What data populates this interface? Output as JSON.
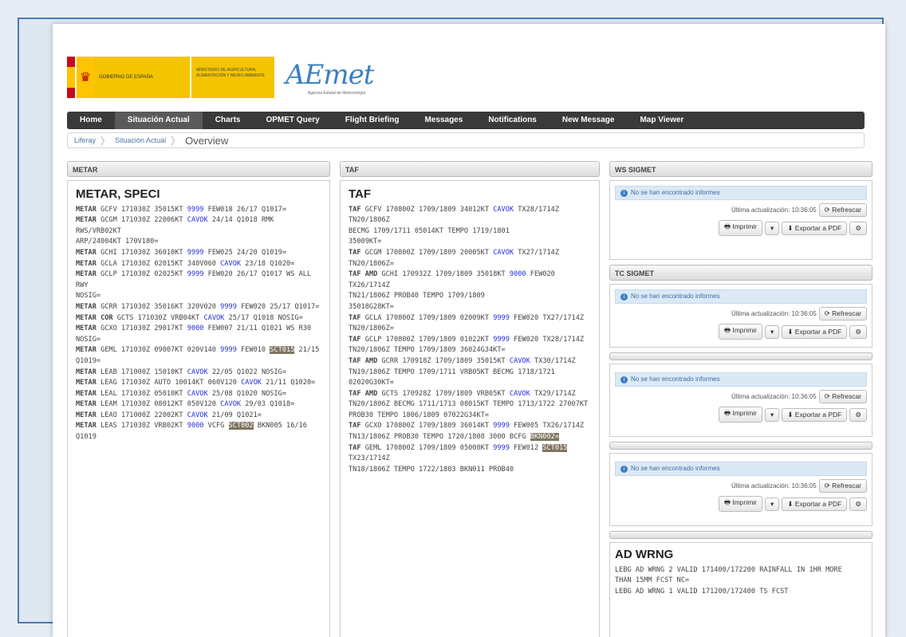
{
  "header": {
    "gov_label": "GOBIERNO DE ESPAÑA",
    "ministry_label": "MINISTERIO DE AGRICULTURA, ALIMENTACIÓN Y MEDIO AMBIENTE",
    "brand": "AEmet",
    "brand_sub": "Agencia Estatal de Meteorología"
  },
  "nav": {
    "items": [
      "Home",
      "Situación Actual",
      "Charts",
      "OPMET Query",
      "Flight Briefing",
      "Messages",
      "Notifications",
      "New Message",
      "Map Viewer"
    ],
    "active_index": 1
  },
  "breadcrumb": {
    "items": [
      "Liferay",
      "Situación Actual",
      "Overview"
    ]
  },
  "metar": {
    "header": "METAR",
    "title": "METAR, SPECI",
    "lines": [
      "METAR GCFV 171030Z 35015KT 9999 FEW018 26/17 Q1017=",
      "METAR GCGM 171030Z 22006KT CAVOK 24/14 Q1018 RMK RWS/VRB02KT",
      "ARP/24004KT 170V180=",
      "METAR GCHI 171030Z 36010KT 9999 FEW025 24/20 Q1019=",
      "METAR GCLA 171030Z 02015KT 340V060 CAVOK 23/18 Q1020=",
      "METAR GCLP 171030Z 02025KT 9999 FEW020 26/17 Q1017 WS ALL RWY",
      "NOSIG=",
      "METAR GCRR 171030Z 35016KT 320V020 9999 FEW020 25/17 Q1017=",
      "METAR COR GCTS 171030Z VRB04KT CAVOK 25/17 Q1018 NOSIG=",
      "METAR GCXO 171030Z 29017KT 9000 FEW007 21/11 Q1021 WS R30 NOSIG=",
      "METAR GEML 171030Z 09007KT 020V140 9999 FEW010 SCT015 21/15 Q1019=",
      "METAR LEAB 171000Z 15010KT CAVOK 22/05 Q1022 NOSIG=",
      "METAR LEAG 171030Z AUTO 10014KT 060V120 CAVOK 21/11 Q1020=",
      "METAR LEAL 171030Z 05010KT CAVOK 25/08 Q1020 NOSIG=",
      "METAR LEAM 171030Z 08012KT 050V120 CAVOK 29/03 Q1018=",
      "METAR LEAO 171000Z 22002KT CAVOK 21/09 Q1021=",
      "METAR LEAS 171030Z VRB02KT 9000 VCFG SCT002 BKN005 16/16 Q1019"
    ]
  },
  "taf": {
    "header": "TAF",
    "title": "TAF",
    "lines": [
      "TAF GCFV 170800Z 1709/1809 34012KT CAVOK TX28/1714Z TN20/1806Z",
      "BECMG 1709/1711 05014KT TEMPO 1719/1801",
      "35009KT=",
      "TAF GCGM 170800Z 1709/1809 20005KT CAVOK TX27/1714Z TN20/1806Z=",
      "TAF AMD GCHI 170932Z 1709/1809 35018KT 9000 FEW020 TX26/1714Z",
      "TN21/1806Z PROB40 TEMPO 1709/1809",
      "35018G28KT=",
      "TAF GCLA 170800Z 1709/1809 02009KT 9999 FEW020 TX27/1714Z",
      "TN20/1806Z=",
      "TAF GCLP 170800Z 1709/1809 01022KT 9999 FEW020 TX28/1714Z",
      "TN20/1806Z TEMPO 1709/1809 36024G34KT=",
      "TAF AMD GCRR 170918Z 1709/1809 35015KT CAVOK TX30/1714Z",
      "TN19/1806Z TEMPO 1709/1711 VRB05KT BECMG 1718/1721 02020G30KT=",
      "TAF AMD GCTS 170928Z 1709/1809 VRB05KT CAVOK TX29/1714Z",
      "TN20/1806Z BECMG 1711/1713 08015KT TEMPO 1713/1722 27007KT",
      "PROB30 TEMPO 1806/1809 07022G34KT=",
      "TAF GCXO 170800Z 1709/1809 36014KT 9999 FEW005 TX26/1714Z",
      "TN13/1806Z PROB30 TEMPO 1720/1808 3000 BCFG BKN002=",
      "TAF GEML 170800Z 1709/1809 05008KT 9999 FEW012 SCT015 TX23/1714Z",
      "TN18/1806Z TEMPO 1722/1803 BKN011 PROB40"
    ]
  },
  "ws_sigmet": {
    "header": "WS SIGMET",
    "info": "No se han encontrado informes",
    "updated_label": "Última actualización: 10:36:05",
    "refresh": "Refrescar",
    "print": "Imprimir",
    "export": "Exportar a PDF"
  },
  "tc_sigmet": {
    "header": "TC SIGMET",
    "info": "No se han encontrado informes",
    "updated_label": "Última actualización: 10:36:05",
    "refresh": "Refrescar",
    "print": "Imprimir",
    "export": "Exportar a PDF"
  },
  "panel3": {
    "info": "No se han encontrado informes",
    "updated_label": "Última actualización: 10:36:05",
    "refresh": "Refrescar",
    "print": "Imprimir",
    "export": "Exportar a PDF"
  },
  "panel4": {
    "info": "No se han encontrado informes",
    "updated_label": "Última actualización: 10:36:05",
    "refresh": "Refrescar",
    "print": "Imprimir",
    "export": "Exportar a PDF"
  },
  "adwrng": {
    "title": "AD WRNG",
    "lines": [
      "LEBG AD WRNG 2 VALID 171400/172200 RAINFALL IN 1HR MORE",
      "THAN 15MM FCST NC=",
      "LEBG AD WRNG 1 VALID 171200/172400 TS FCST"
    ]
  },
  "highlight_tokens": {
    "blue": [
      "9999",
      "CAVOK",
      "9000"
    ],
    "dark": [
      "SCT015",
      "SCT002",
      "BKN002"
    ]
  }
}
